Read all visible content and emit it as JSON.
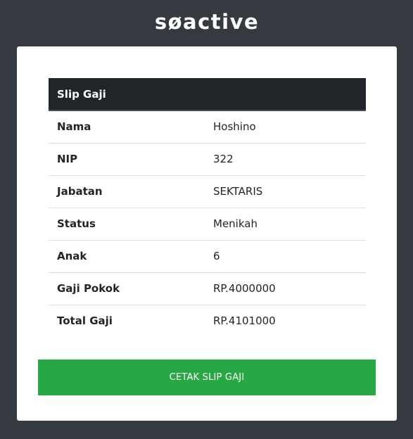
{
  "brand": {
    "logo_text": "søactive"
  },
  "slip": {
    "title": "Slip Gaji",
    "rows": [
      {
        "label": "Nama",
        "value": "Hoshino"
      },
      {
        "label": "NIP",
        "value": "322"
      },
      {
        "label": "Jabatan",
        "value": "SEKTARIS"
      },
      {
        "label": "Status",
        "value": "Menikah"
      },
      {
        "label": "Anak",
        "value": "6"
      },
      {
        "label": "Gaji Pokok",
        "value": "RP.4000000"
      },
      {
        "label": "Total Gaji",
        "value": "RP.4101000"
      }
    ]
  },
  "actions": {
    "print_label": "CETAK SLIP GAJI"
  },
  "colors": {
    "page_background": "#343a40",
    "header_background": "#212529",
    "button_background": "#28a745"
  }
}
